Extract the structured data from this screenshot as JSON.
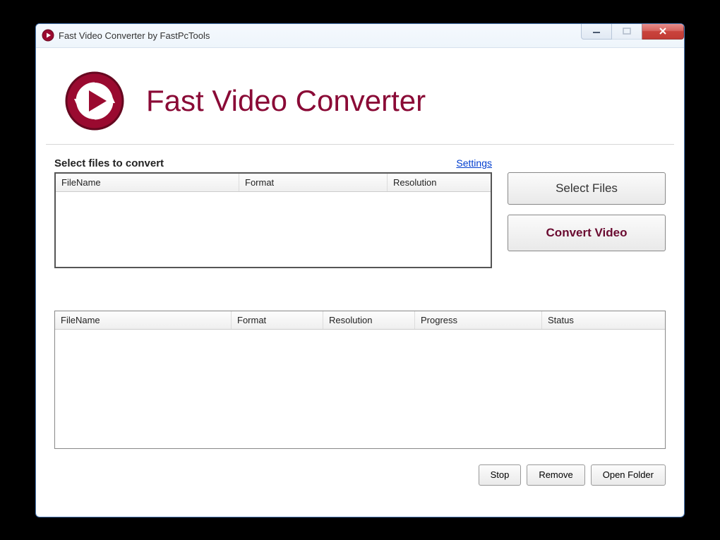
{
  "window": {
    "title": "Fast Video Converter by FastPcTools"
  },
  "header": {
    "app_title": "Fast Video Converter"
  },
  "input_section": {
    "label": "Select files to convert",
    "settings_link": "Settings",
    "columns": {
      "filename": "FileName",
      "format": "Format",
      "resolution": "Resolution"
    }
  },
  "buttons": {
    "select_files": "Select Files",
    "convert_video": "Convert Video",
    "stop": "Stop",
    "remove": "Remove",
    "open_folder": "Open Folder"
  },
  "output_section": {
    "columns": {
      "filename": "FileName",
      "format": "Format",
      "resolution": "Resolution",
      "progress": "Progress",
      "status": "Status"
    }
  }
}
